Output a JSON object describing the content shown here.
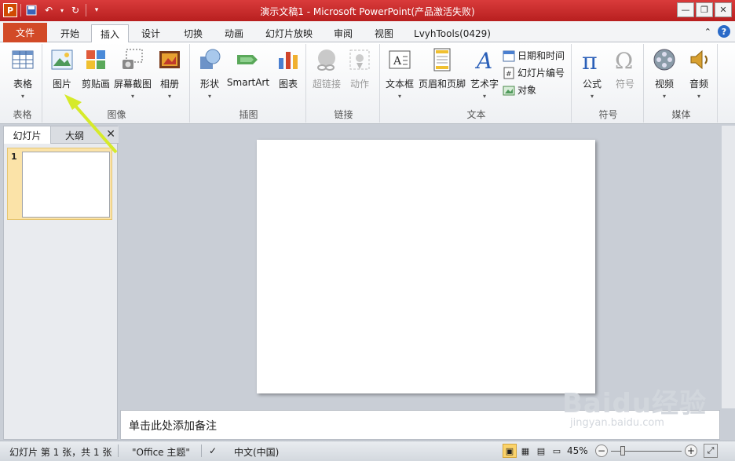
{
  "window": {
    "title": "演示文稿1  -  Microsoft PowerPoint(产品激活失败)"
  },
  "tabs": [
    {
      "label": "文件"
    },
    {
      "label": "开始"
    },
    {
      "label": "插入"
    },
    {
      "label": "设计"
    },
    {
      "label": "切换"
    },
    {
      "label": "动画"
    },
    {
      "label": "幻灯片放映"
    },
    {
      "label": "审阅"
    },
    {
      "label": "视图"
    },
    {
      "label": "LvyhTools(0429)"
    }
  ],
  "ribbon": {
    "groups": {
      "table": {
        "label": "表格",
        "btn_table": "表格"
      },
      "images": {
        "label": "图像",
        "btn_picture": "图片",
        "btn_clipart": "剪贴画",
        "btn_screenshot": "屏幕截图",
        "btn_album": "相册"
      },
      "illustrations": {
        "label": "插图",
        "btn_shapes": "形状",
        "btn_smartart": "SmartArt",
        "btn_chart": "图表"
      },
      "links": {
        "label": "链接",
        "btn_hyperlink": "超链接",
        "btn_action": "动作"
      },
      "text": {
        "label": "文本",
        "btn_textbox": "文本框",
        "btn_headerfooter": "页眉和页脚",
        "btn_wordart": "艺术字",
        "btn_datetime": "日期和时间",
        "btn_slidenumber": "幻灯片编号",
        "btn_object": "对象"
      },
      "symbols": {
        "label": "符号",
        "btn_equation": "公式",
        "btn_symbol": "符号"
      },
      "media": {
        "label": "媒体",
        "btn_video": "视频",
        "btn_audio": "音频"
      }
    }
  },
  "slide_panel": {
    "tab_slides": "幻灯片",
    "tab_outline": "大纲",
    "thumb_number": "1"
  },
  "notes": {
    "placeholder": "单击此处添加备注"
  },
  "status": {
    "slide_info": "幻灯片 第 1 张，共 1 张",
    "theme": "\"Office 主题\"",
    "language": "中文(中国)",
    "zoom": "45%"
  },
  "watermark": {
    "main": "Baidu经验",
    "sub": "jingyan.baidu.com"
  }
}
